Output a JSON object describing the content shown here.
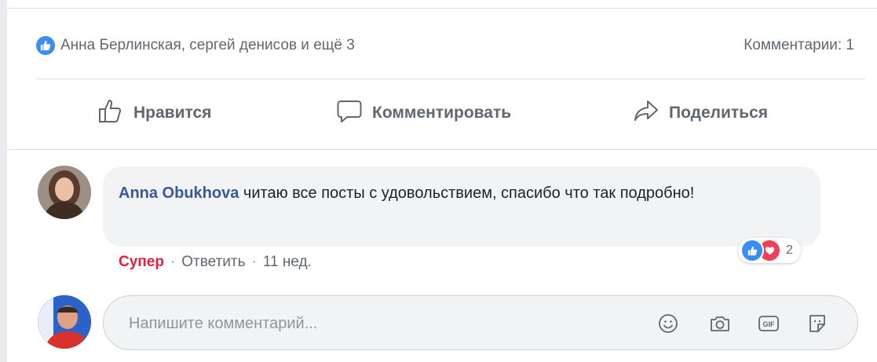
{
  "post": {
    "likers_text": "Анна Берлинская, сергей денисов и ещё 3",
    "comments_count_text": "Комментарии: 1"
  },
  "actions": {
    "like_label": "Нравится",
    "comment_label": "Комментировать",
    "share_label": "Поделиться"
  },
  "comment": {
    "author": "Anna Obukhova",
    "text": " читаю все посты с удовольствием, спасибо что так подробно!",
    "reaction_label": "Супер",
    "separator": "·",
    "reply_label": "Ответить",
    "time": "11 нед.",
    "reactions_count": "2"
  },
  "composer": {
    "placeholder": "Напишите комментарий..."
  },
  "colors": {
    "link": "#385898",
    "love": "#e81c3e",
    "like_blue": "#3b8df6"
  }
}
